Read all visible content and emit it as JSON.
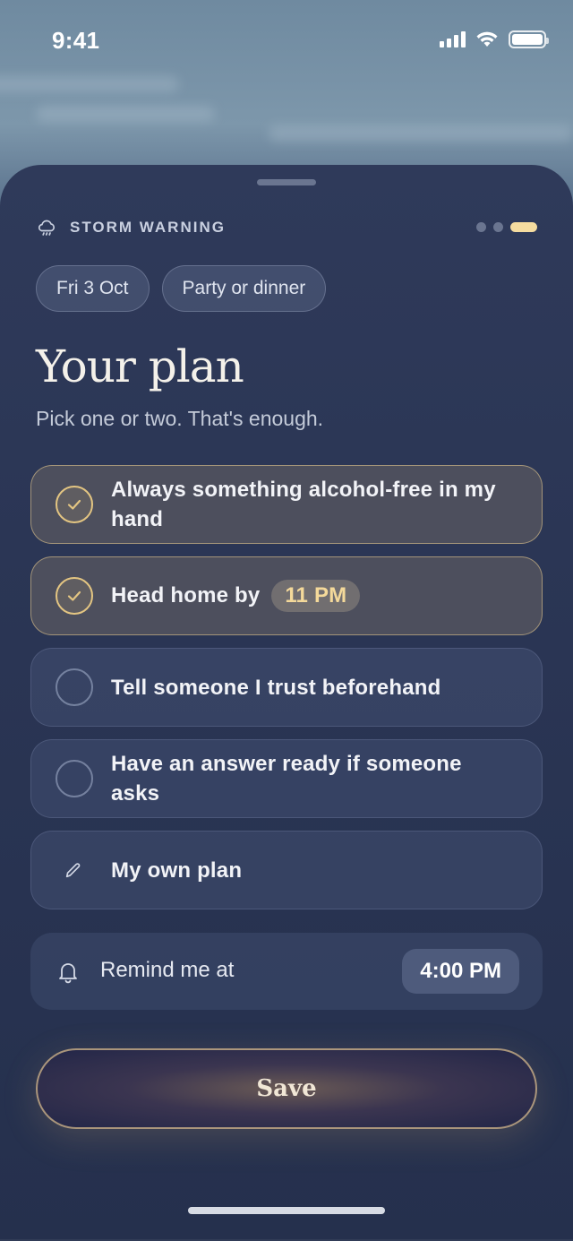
{
  "status_bar": {
    "time": "9:41",
    "signal_icon": "cellular-signal-icon",
    "wifi_icon": "wifi-icon",
    "battery_icon": "battery-icon"
  },
  "header": {
    "warning_icon": "storm-cloud-icon",
    "warning_label": "STORM WARNING",
    "progress_steps": 3,
    "active_step": 3
  },
  "chips": [
    {
      "label": "Fri 3 Oct"
    },
    {
      "label": "Party or dinner"
    }
  ],
  "title": "Your plan",
  "subtitle": "Pick one or two. That's enough.",
  "options": [
    {
      "label": "Always something alcohol-free in my hand",
      "checked": true
    },
    {
      "label": "Head home by",
      "time": "11 PM",
      "checked": true
    },
    {
      "label": "Tell someone I trust beforehand",
      "checked": false
    },
    {
      "label": "Have an answer ready if someone asks",
      "checked": false
    }
  ],
  "own_plan": {
    "label": "My own plan",
    "icon": "pencil-icon"
  },
  "reminder": {
    "icon": "bell-icon",
    "label": "Remind me at",
    "time": "4:00 PM"
  },
  "save_label": "Save",
  "colors": {
    "accent": "#f5dca0",
    "check": "#e3c582",
    "sheet": "#2b3655"
  }
}
